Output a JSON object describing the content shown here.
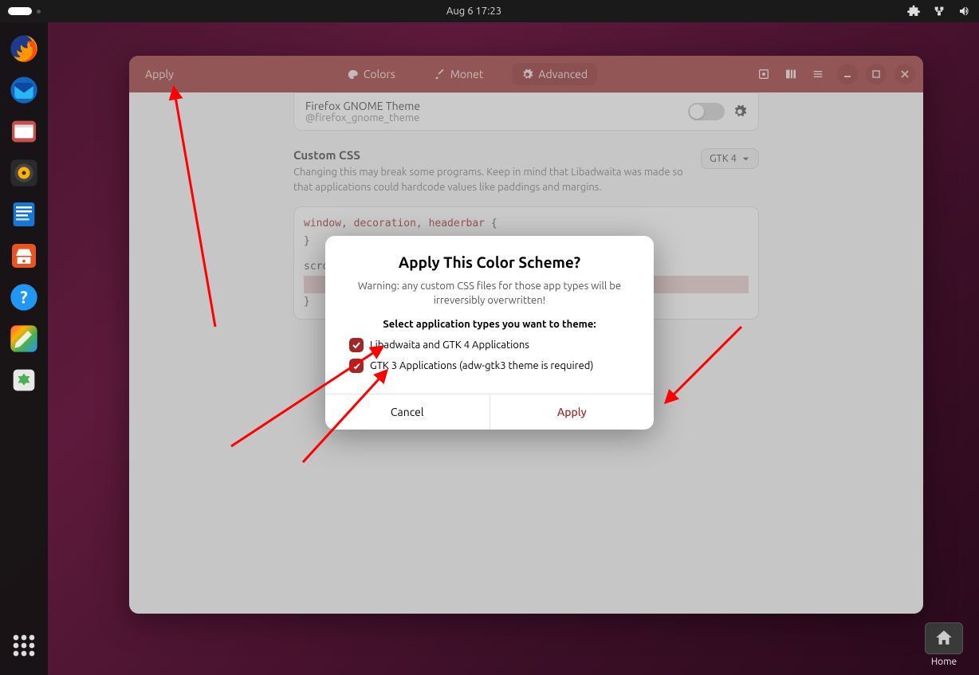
{
  "topbar": {
    "datetime": "Aug 6  17:23"
  },
  "dock": {
    "apps": [
      "firefox",
      "thunderbird",
      "files",
      "rhythmbox",
      "libreoffice-writer",
      "software",
      "help",
      "gradience",
      "trash"
    ]
  },
  "desktop": {
    "home_label": "Home"
  },
  "window": {
    "apply_label": "Apply",
    "tabs": {
      "colors": "Colors",
      "monet": "Monet",
      "advanced": "Advanced"
    },
    "theme_row": {
      "title": "Firefox GNOME Theme",
      "subtitle": "@firefox_gnome_theme"
    },
    "custom_css": {
      "heading": "Custom CSS",
      "desc": "Changing this may break some programs. Keep in mind that Libadwaita was made so that applications could hardcode values like paddings and margins.",
      "dropdown": "GTK 4",
      "code_line1_a": "window",
      "code_line1_b": ", ",
      "code_line1_c": "decoration",
      "code_line1_d": ", ",
      "code_line1_e": "headerbar",
      "code_line1_f": " {",
      "code_line2": "}",
      "code_line3": "scrollba",
      "code_line4": "}"
    }
  },
  "dialog": {
    "title": "Apply This Color Scheme?",
    "warning": "Warning: any custom CSS files for those app types will be irreversibly overwritten!",
    "select_label": "Select application types you want to theme:",
    "opt1": "Libadwaita and GTK 4 Applications",
    "opt2": "GTK 3 Applications (adw-gtk3 theme is required)",
    "cancel": "Cancel",
    "apply": "Apply"
  }
}
